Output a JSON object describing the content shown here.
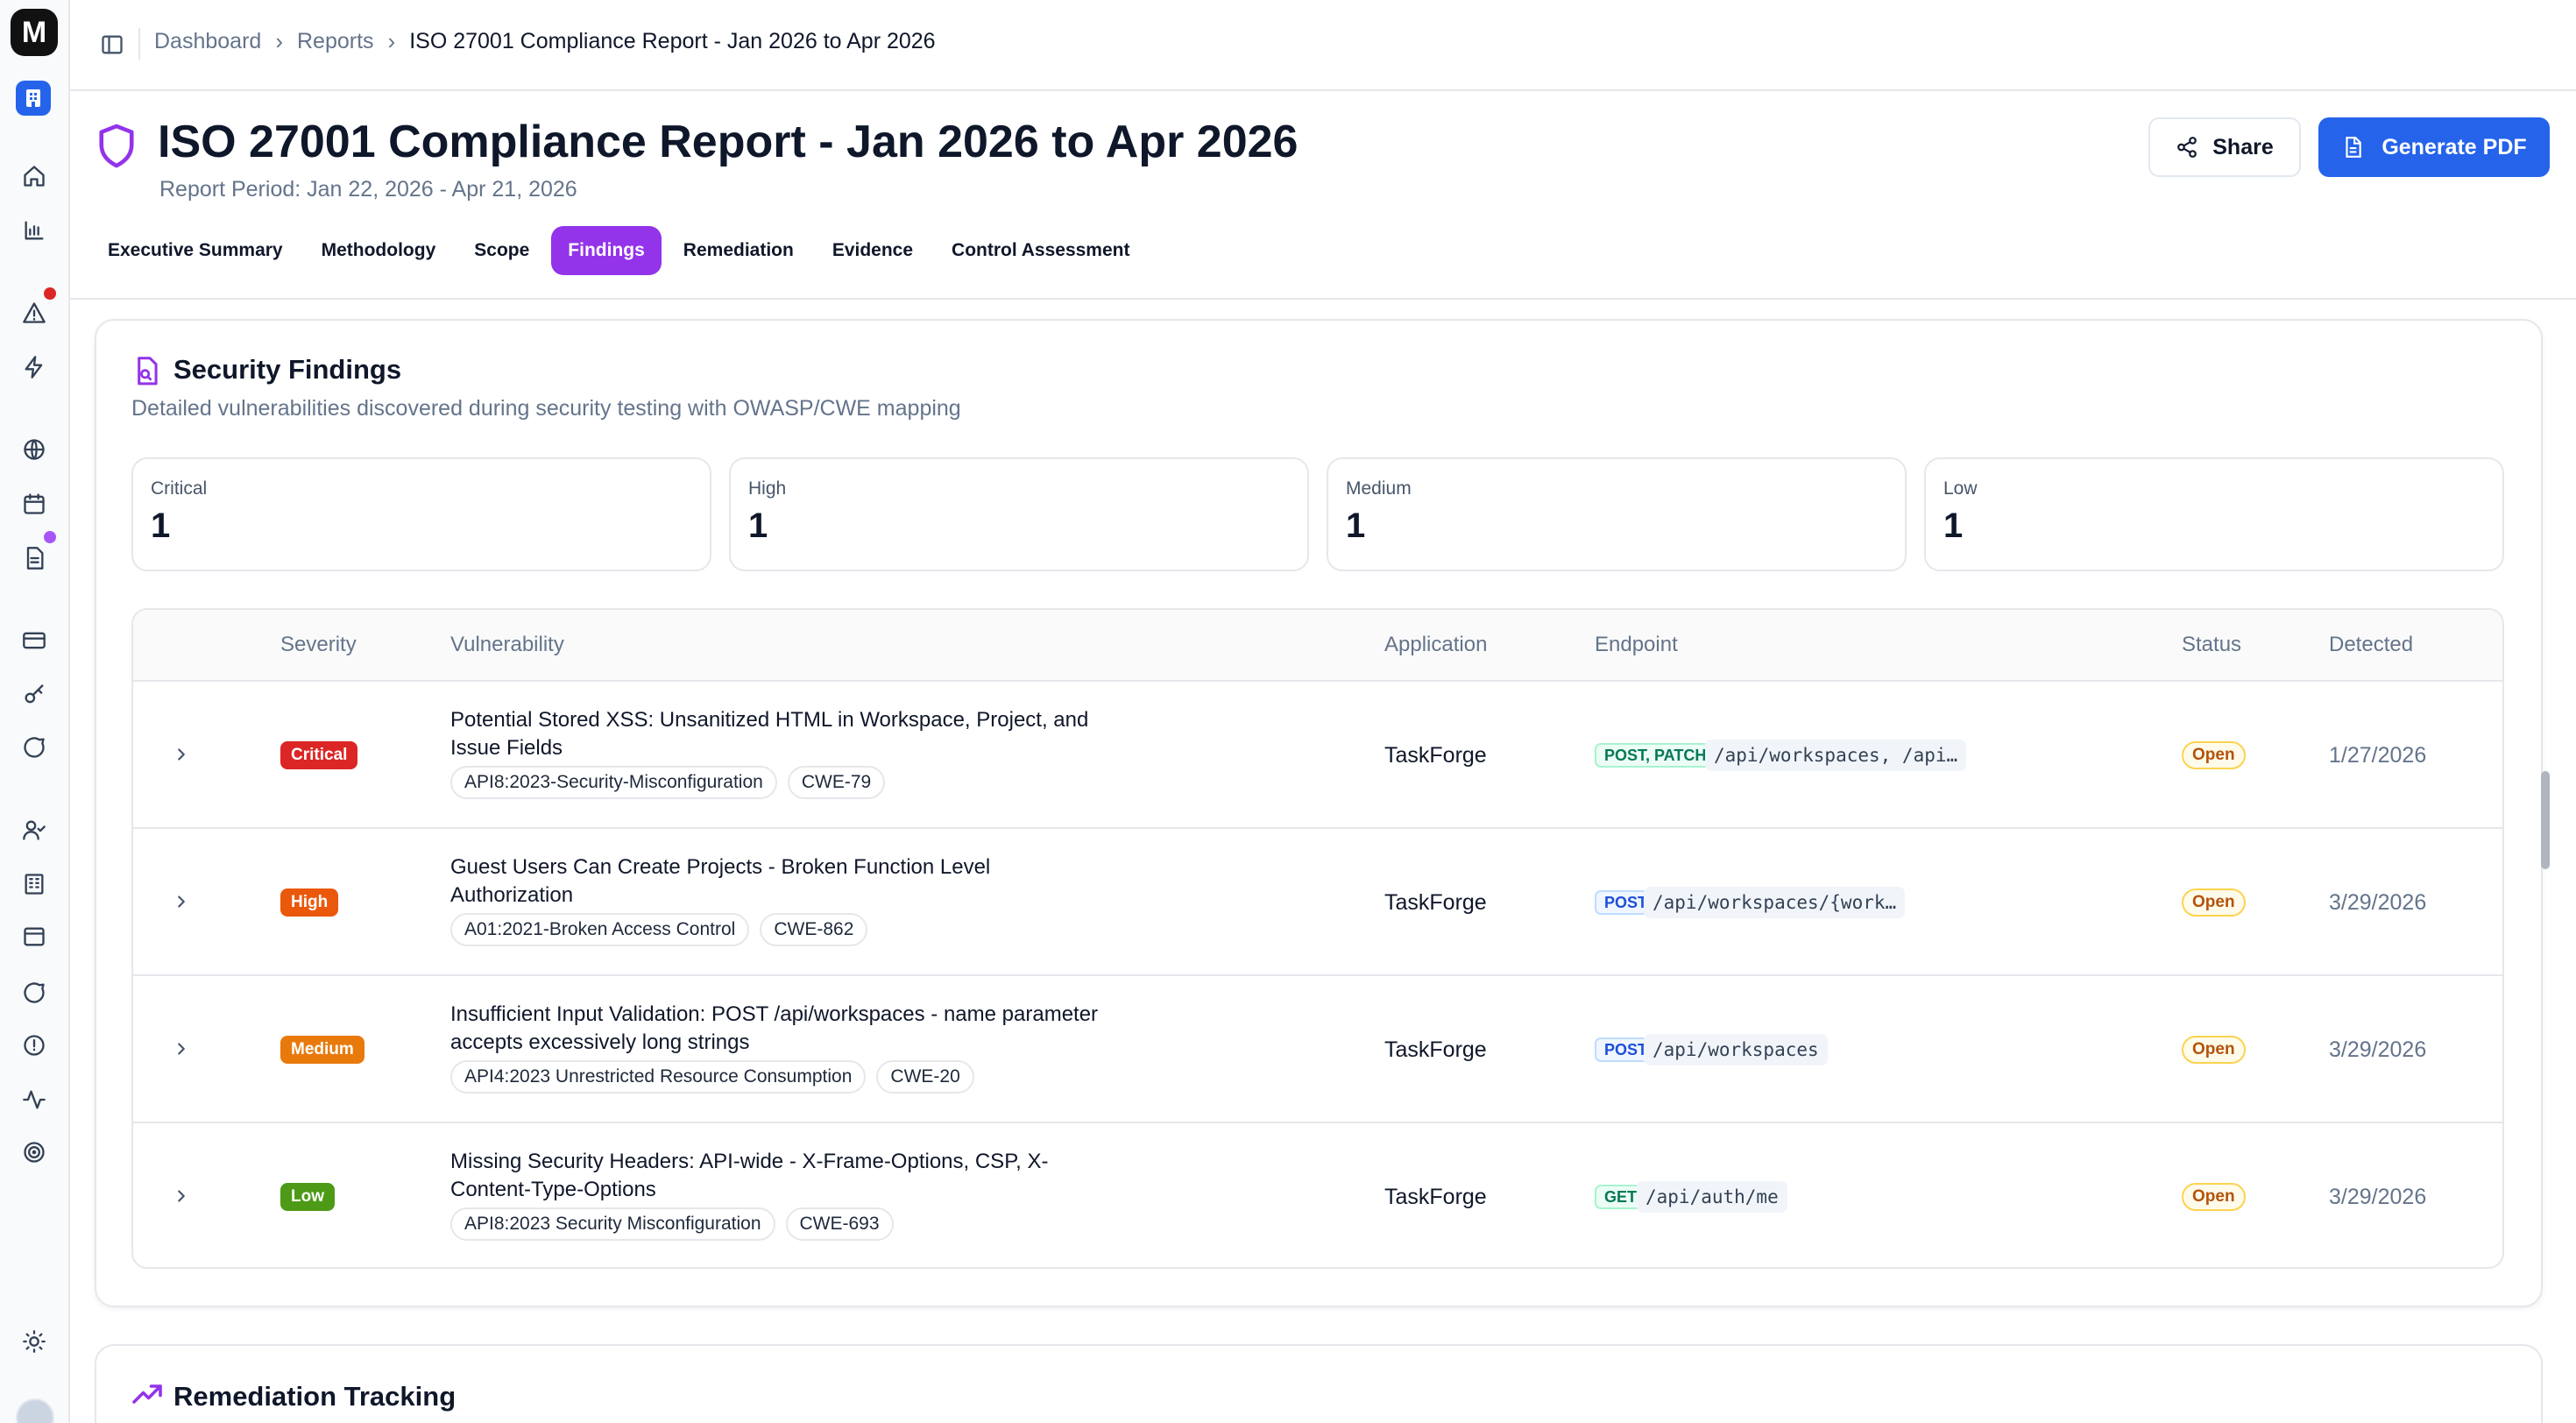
{
  "brand": {
    "logo_letter": "M"
  },
  "breadcrumbs": [
    "Dashboard",
    "Reports",
    "ISO 27001 Compliance Report - Jan 2026 to Apr 2026"
  ],
  "header": {
    "title": "ISO 27001 Compliance Report - Jan 2026 to Apr 2026",
    "period": "Report Period: Jan 22, 2026 - Apr 21, 2026",
    "share_label": "Share",
    "pdf_label": "Generate PDF"
  },
  "tabs": [
    {
      "label": "Executive Summary",
      "active": false
    },
    {
      "label": "Methodology",
      "active": false
    },
    {
      "label": "Scope",
      "active": false
    },
    {
      "label": "Findings",
      "active": true
    },
    {
      "label": "Remediation",
      "active": false
    },
    {
      "label": "Evidence",
      "active": false
    },
    {
      "label": "Control Assessment",
      "active": false
    }
  ],
  "findings": {
    "title": "Security Findings",
    "subtitle": "Detailed vulnerabilities discovered during security testing with OWASP/CWE mapping",
    "stats": [
      {
        "label": "Critical",
        "value": "1"
      },
      {
        "label": "High",
        "value": "1"
      },
      {
        "label": "Medium",
        "value": "1"
      },
      {
        "label": "Low",
        "value": "1"
      }
    ],
    "columns": [
      "Severity",
      "Vulnerability",
      "Application",
      "Endpoint",
      "Status",
      "Detected"
    ],
    "rows": [
      {
        "severity": "Critical",
        "title": "Potential Stored XSS: Unsanitized HTML in Workspace, Project, and Issue Fields",
        "tags": [
          "API8:2023-Security-Misconfiguration",
          "CWE-79"
        ],
        "application": "TaskForge",
        "method": "POST, PATCH",
        "path": "/api/workspaces, /api…",
        "status": "Open",
        "detected": "1/27/2026"
      },
      {
        "severity": "High",
        "title": "Guest Users Can Create Projects - Broken Function Level Authorization",
        "tags": [
          "A01:2021-Broken Access Control",
          "CWE-862"
        ],
        "application": "TaskForge",
        "method": "POST",
        "path": "/api/workspaces/{work…",
        "status": "Open",
        "detected": "3/29/2026"
      },
      {
        "severity": "Medium",
        "title": "Insufficient Input Validation: POST /api/workspaces - name parameter accepts excessively long strings",
        "tags": [
          "API4:2023 Unrestricted Resource Consumption",
          "CWE-20"
        ],
        "application": "TaskForge",
        "method": "POST",
        "path": "/api/workspaces",
        "status": "Open",
        "detected": "3/29/2026"
      },
      {
        "severity": "Low",
        "title": "Missing Security Headers: API-wide - X-Frame-Options, CSP, X-Content-Type-Options",
        "tags": [
          "API8:2023 Security Misconfiguration",
          "CWE-693"
        ],
        "application": "TaskForge",
        "method": "GET",
        "path": "/api/auth/me",
        "status": "Open",
        "detected": "3/29/2026"
      }
    ]
  },
  "remediation": {
    "title": "Remediation Tracking"
  },
  "colors": {
    "accent_purple": "#9333ea",
    "primary_blue": "#2563eb",
    "critical": "#dc2626",
    "high": "#ea580c",
    "medium": "#e87a0c",
    "low": "#4d9a16"
  }
}
